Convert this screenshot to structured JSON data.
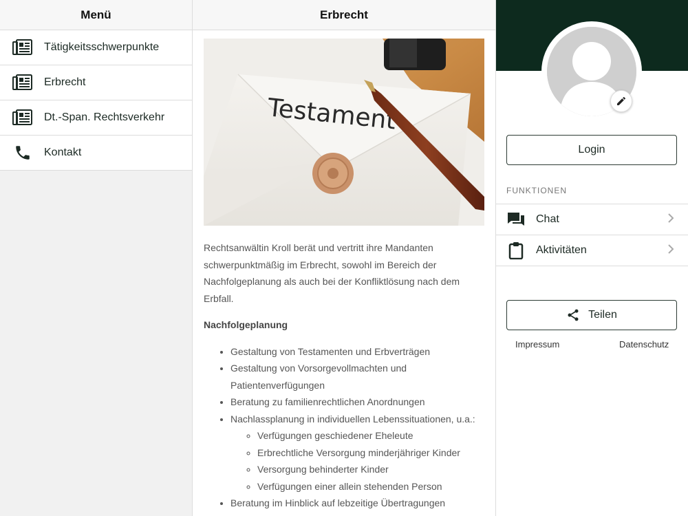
{
  "left": {
    "title": "Menü",
    "items": [
      {
        "label": "Tätigkeitsschwerpunkte",
        "icon": "newspaper-icon"
      },
      {
        "label": "Erbrecht",
        "icon": "newspaper-icon"
      },
      {
        "label": "Dt.-Span. Rechtsverkehr",
        "icon": "newspaper-icon"
      },
      {
        "label": "Kontakt",
        "icon": "phone-icon"
      }
    ]
  },
  "center": {
    "title": "Erbrecht",
    "hero_text": "Testament",
    "intro": "Rechtsanwältin Kroll berät und vertritt ihre Mandanten schwerpunktmäßig im Erbrecht, sowohl im Bereich der Nachfolgeplanung als auch bei der Konfliktlösung nach dem Erbfall.",
    "subhead": "Nachfolgeplanung",
    "bullets": [
      "Gestaltung von Testamenten und Erbverträgen",
      "Gestaltung von Vorsorgevollmachten und Patientenverfügungen",
      "Beratung zu familienrechtlichen Anordnungen",
      "Nachlassplanung in individuellen Lebenssituationen, u.a.:",
      "Beratung im Hinblick auf lebzeitige Übertragungen"
    ],
    "sub_bullets": [
      "Verfügungen geschiedener Eheleute",
      "Erbrechtliche Versorgung minderjähriger Kinder",
      "Versorgung behinderter Kinder",
      "Verfügungen einer allein stehenden Person"
    ]
  },
  "right": {
    "login_label": "Login",
    "section_label": "FUNKTIONEN",
    "functions": [
      {
        "label": "Chat",
        "icon": "chat-icon"
      },
      {
        "label": "Aktivitäten",
        "icon": "clipboard-icon"
      }
    ],
    "share_label": "Teilen",
    "impressum": "Impressum",
    "datenschutz": "Datenschutz"
  },
  "colors": {
    "banner": "#0d2a1e",
    "accent": "#1d2a24"
  }
}
